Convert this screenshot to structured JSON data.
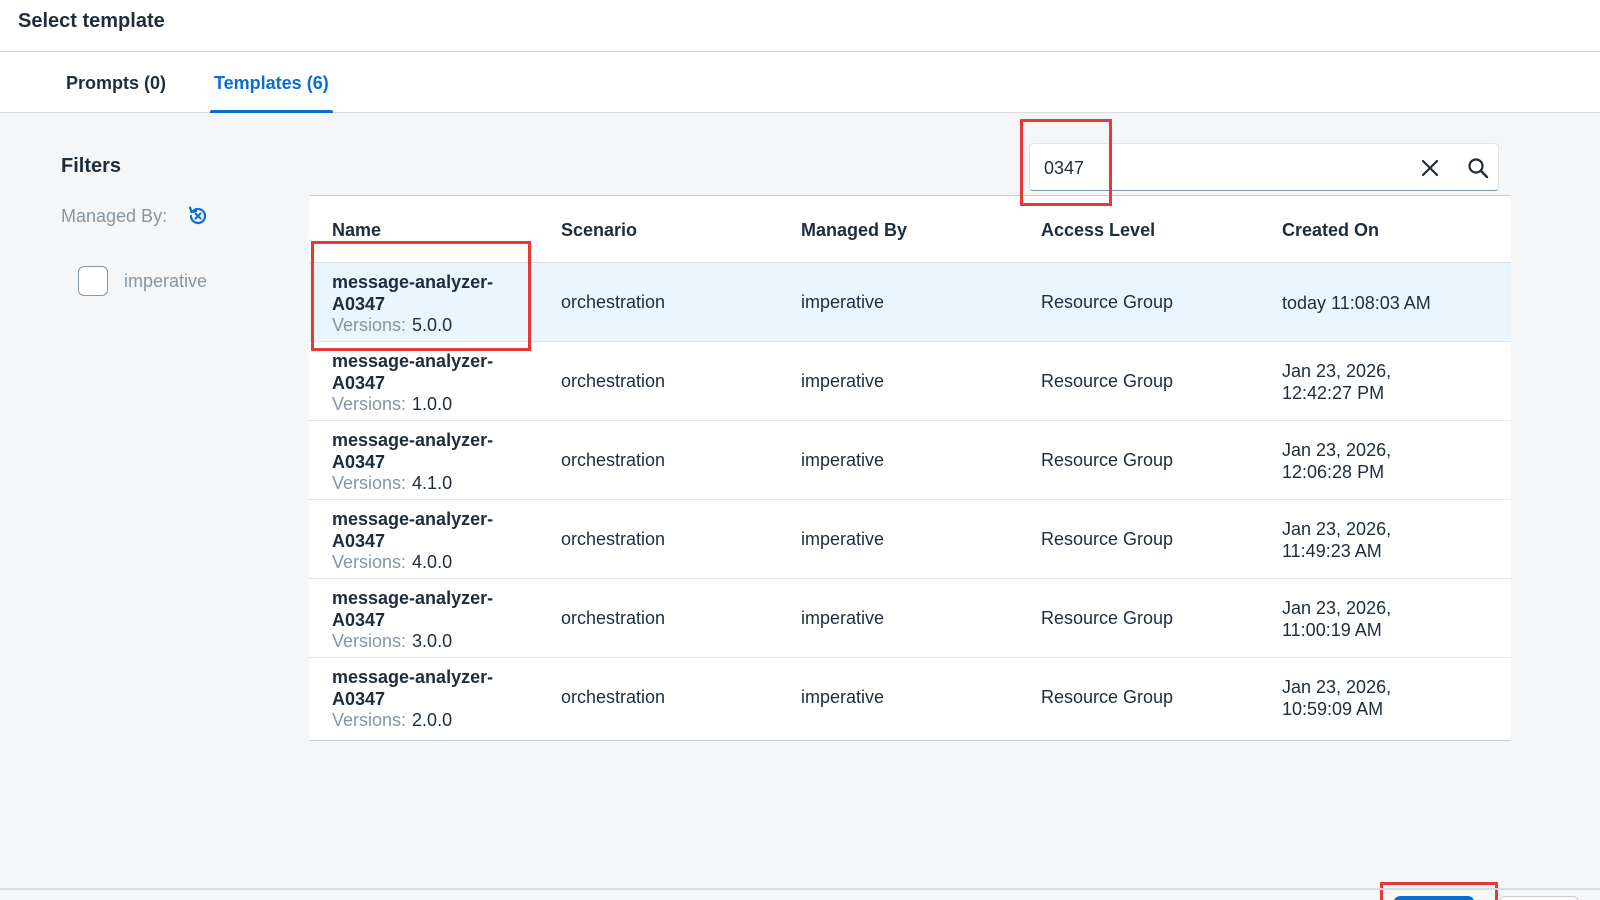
{
  "dialog": {
    "title": "Select template"
  },
  "tabs": [
    {
      "label": "Prompts (0)"
    },
    {
      "label": "Templates (6)"
    }
  ],
  "filters": {
    "title": "Filters",
    "managed_by_label": "Managed By:",
    "options": [
      {
        "label": "imperative",
        "checked": false
      }
    ]
  },
  "search": {
    "value": "0347"
  },
  "table": {
    "columns": [
      "Name",
      "Scenario",
      "Managed By",
      "Access Level",
      "Created On"
    ],
    "rows": [
      {
        "name": "message-analyzer-A0347",
        "versions_label": "Versions:",
        "version": "5.0.0",
        "scenario": "orchestration",
        "managed_by": "imperative",
        "access_level": "Resource Group",
        "created_on": "today 11:08:03 AM",
        "selected": true
      },
      {
        "name": "message-analyzer-A0347",
        "versions_label": "Versions:",
        "version": "1.0.0",
        "scenario": "orchestration",
        "managed_by": "imperative",
        "access_level": "Resource Group",
        "created_on": "Jan 23, 2026,\n12:42:27 PM",
        "selected": false
      },
      {
        "name": "message-analyzer-A0347",
        "versions_label": "Versions:",
        "version": "4.1.0",
        "scenario": "orchestration",
        "managed_by": "imperative",
        "access_level": "Resource Group",
        "created_on": "Jan 23, 2026,\n12:06:28 PM",
        "selected": false
      },
      {
        "name": "message-analyzer-A0347",
        "versions_label": "Versions:",
        "version": "4.0.0",
        "scenario": "orchestration",
        "managed_by": "imperative",
        "access_level": "Resource Group",
        "created_on": "Jan 23, 2026,\n11:49:23 AM",
        "selected": false
      },
      {
        "name": "message-analyzer-A0347",
        "versions_label": "Versions:",
        "version": "3.0.0",
        "scenario": "orchestration",
        "managed_by": "imperative",
        "access_level": "Resource Group",
        "created_on": "Jan 23, 2026,\n11:00:19 AM",
        "selected": false
      },
      {
        "name": "message-analyzer-A0347",
        "versions_label": "Versions:",
        "version": "2.0.0",
        "scenario": "orchestration",
        "managed_by": "imperative",
        "access_level": "Resource Group",
        "created_on": "Jan 23, 2026,\n10:59:09 AM",
        "selected": false
      }
    ]
  },
  "icons": {
    "reset": "reset-filter-icon",
    "clear": "close-icon",
    "search": "search-icon"
  },
  "colors": {
    "accent": "#0a6ed1",
    "highlight_box": "#e53935",
    "selected_row": "#ebf5fe"
  }
}
